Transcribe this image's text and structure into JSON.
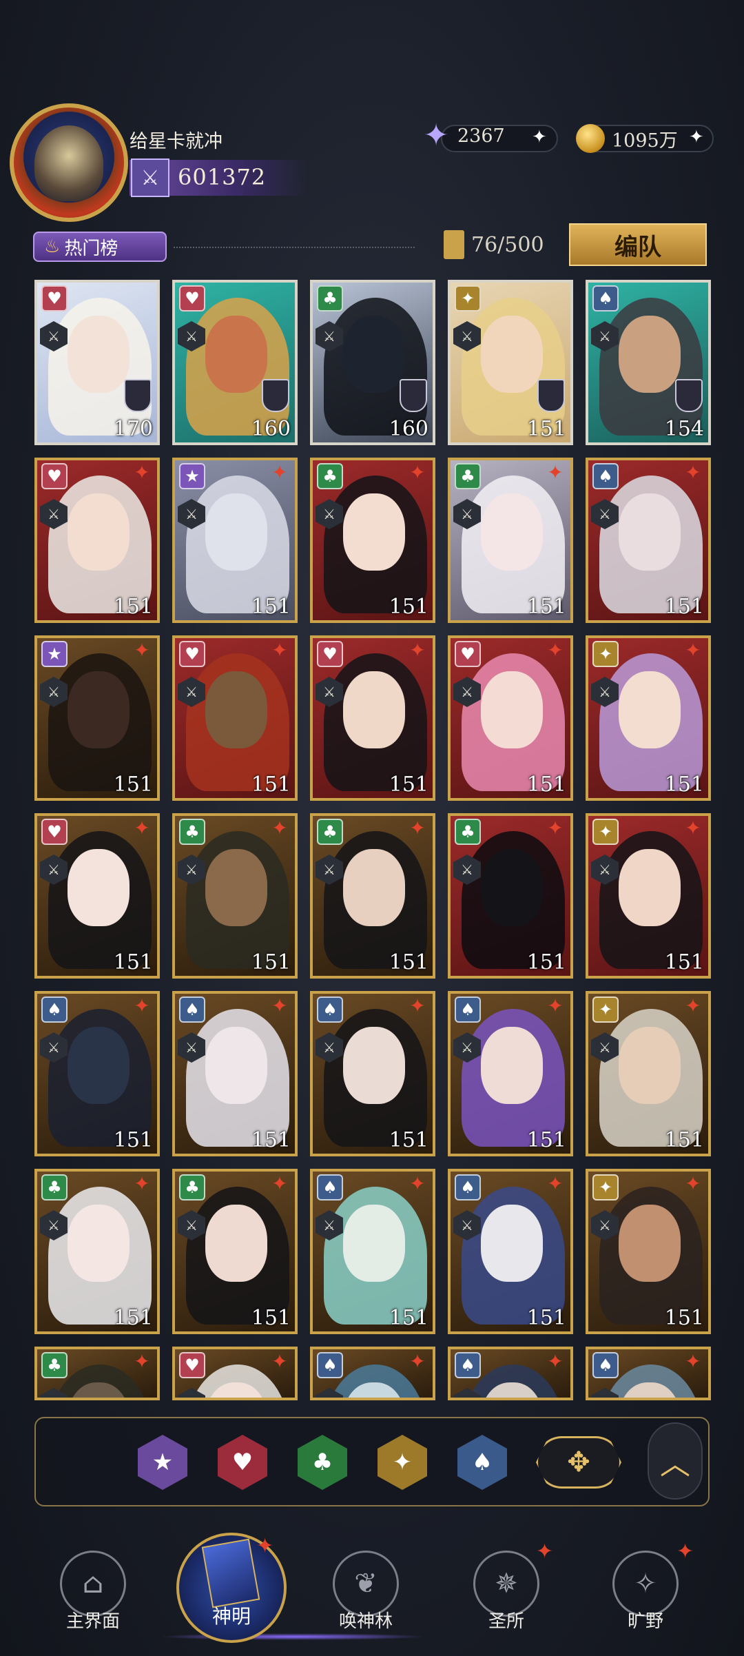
{
  "header": {
    "player_name": "给星卡就冲",
    "rank_score": "601372",
    "star_currency": "2367",
    "gold_currency": "1095万",
    "plus_symbol": "✦"
  },
  "list_bar": {
    "hot_tab_label": "热门榜",
    "card_count": "76/500",
    "team_button": "编队"
  },
  "cards": [
    {
      "level": "170",
      "suit": "heart",
      "suit_color": "#b24050",
      "top": true,
      "bg": [
        "#dfe6f2",
        "#a7b6d8"
      ],
      "face": "#f3e2d8",
      "hair": "#f7f3ea"
    },
    {
      "level": "160",
      "suit": "heart",
      "suit_color": "#b24050",
      "top": true,
      "bg": [
        "#2fb3a4",
        "#1d6e6a"
      ],
      "face": "#c9744a",
      "hair": "#d9a24a"
    },
    {
      "level": "160",
      "suit": "club",
      "suit_color": "#2d8a48",
      "top": true,
      "bg": [
        "#b9c4d6",
        "#3c4454"
      ],
      "face": "#1e2330",
      "hair": "#0f1218"
    },
    {
      "level": "151",
      "suit": "diamond",
      "suit_color": "#a8842c",
      "top": true,
      "bg": [
        "#e8d6b4",
        "#c9a870"
      ],
      "face": "#f1d6bc",
      "hair": "#e8cf8a"
    },
    {
      "level": "154",
      "suit": "spade",
      "suit_color": "#3d5c8c",
      "top": true,
      "bg": [
        "#2fb3a4",
        "#1b5d5a"
      ],
      "face": "#c9a080",
      "hair": "#3c3a40"
    },
    {
      "level": "151",
      "suit": "heart",
      "suit_color": "#b24050",
      "bg": [
        "#9c2a2a",
        "#5a1414"
      ],
      "face": "#f2ddd0",
      "hair": "#ecebe6"
    },
    {
      "level": "151",
      "suit": "star",
      "suit_color": "#7b56b8",
      "bg": [
        "#8a8fa6",
        "#4a4e60"
      ],
      "face": "#dfe2ea",
      "hair": "#d9dce6"
    },
    {
      "level": "151",
      "suit": "club",
      "suit_color": "#2d8a48",
      "bg": [
        "#9c2a2a",
        "#5a1414"
      ],
      "face": "#f2ddd0",
      "hair": "#141418"
    },
    {
      "level": "151",
      "suit": "club",
      "suit_color": "#2d8a48",
      "bg": [
        "#b7b2c2",
        "#5e5a6c"
      ],
      "face": "#f4e6e6",
      "hair": "#f2f0f4"
    },
    {
      "level": "151",
      "suit": "spade",
      "suit_color": "#3d5c8c",
      "bg": [
        "#9c2a2a",
        "#5a1414"
      ],
      "face": "#eadde0",
      "hair": "#dcdde4"
    },
    {
      "level": "151",
      "suit": "star",
      "suit_color": "#7b56b8",
      "bg": [
        "#6a4a24",
        "#2a1c0c"
      ],
      "face": "#3c2a22",
      "hair": "#1a1410"
    },
    {
      "level": "151",
      "suit": "heart",
      "suit_color": "#b24050",
      "bg": [
        "#9c2a2a",
        "#5a1414"
      ],
      "face": "#7a5a3a",
      "hair": "#a6331e"
    },
    {
      "level": "151",
      "suit": "heart",
      "suit_color": "#b24050",
      "bg": [
        "#9c2a2a",
        "#5a1414"
      ],
      "face": "#f0d8c8",
      "hair": "#141418"
    },
    {
      "level": "151",
      "suit": "heart",
      "suit_color": "#b24050",
      "bg": [
        "#9c2a2a",
        "#5a1414"
      ],
      "face": "#f4dcd4",
      "hair": "#e98ab0"
    },
    {
      "level": "151",
      "suit": "diamond",
      "suit_color": "#a8842c",
      "bg": [
        "#9c2a2a",
        "#5a1414"
      ],
      "face": "#f3ddd0",
      "hair": "#b89ad8"
    },
    {
      "level": "151",
      "suit": "heart",
      "suit_color": "#b24050",
      "bg": [
        "#6a4a24",
        "#2a1c0c"
      ],
      "face": "#f4e2dc",
      "hair": "#141418"
    },
    {
      "level": "151",
      "suit": "club",
      "suit_color": "#2d8a48",
      "bg": [
        "#6a4a24",
        "#2a1c0c"
      ],
      "face": "#8a6a4a",
      "hair": "#2a2a22"
    },
    {
      "level": "151",
      "suit": "club",
      "suit_color": "#2d8a48",
      "bg": [
        "#6a4a24",
        "#2a1c0c"
      ],
      "face": "#e8d0c0",
      "hair": "#141418"
    },
    {
      "level": "151",
      "suit": "club",
      "suit_color": "#2d8a48",
      "bg": [
        "#9c2a2a",
        "#5a1414"
      ],
      "face": "#141418",
      "hair": "#0c0c10"
    },
    {
      "level": "151",
      "suit": "diamond",
      "suit_color": "#a8842c",
      "bg": [
        "#9c2a2a",
        "#5a1414"
      ],
      "face": "#f0d6c6",
      "hair": "#141418"
    },
    {
      "level": "151",
      "suit": "spade",
      "suit_color": "#3d5c8c",
      "bg": [
        "#6a4a24",
        "#2a1c0c"
      ],
      "face": "#2a3448",
      "hair": "#1a2030"
    },
    {
      "level": "151",
      "suit": "spade",
      "suit_color": "#3d5c8c",
      "bg": [
        "#6a4a24",
        "#2a1c0c"
      ],
      "face": "#eee6e8",
      "hair": "#e6e4ec"
    },
    {
      "level": "151",
      "suit": "spade",
      "suit_color": "#3d5c8c",
      "bg": [
        "#6a4a24",
        "#2a1c0c"
      ],
      "face": "#eadcd4",
      "hair": "#141418"
    },
    {
      "level": "151",
      "suit": "spade",
      "suit_color": "#3d5c8c",
      "bg": [
        "#6a4a24",
        "#2a1c0c"
      ],
      "face": "#f0dcd6",
      "hair": "#7a54c0"
    },
    {
      "level": "151",
      "suit": "diamond",
      "suit_color": "#a8842c",
      "bg": [
        "#6a4a24",
        "#2a1c0c"
      ],
      "face": "#e6cdb8",
      "hair": "#d8d4c8"
    },
    {
      "level": "151",
      "suit": "club",
      "suit_color": "#2d8a48",
      "bg": [
        "#6a4a24",
        "#2a1c0c"
      ],
      "face": "#f4e6e2",
      "hair": "#ececf0"
    },
    {
      "level": "151",
      "suit": "club",
      "suit_color": "#2d8a48",
      "bg": [
        "#6a4a24",
        "#2a1c0c"
      ],
      "face": "#eedad0",
      "hair": "#141418"
    },
    {
      "level": "151",
      "suit": "spade",
      "suit_color": "#3d5c8c",
      "bg": [
        "#6a4a24",
        "#2a1c0c"
      ],
      "face": "#e4ece6",
      "hair": "#8ad0c8"
    },
    {
      "level": "151",
      "suit": "spade",
      "suit_color": "#3d5c8c",
      "bg": [
        "#6a4a24",
        "#2a1c0c"
      ],
      "face": "#e8e8ec",
      "hair": "#3a4a8a"
    },
    {
      "level": "151",
      "suit": "diamond",
      "suit_color": "#a8842c",
      "bg": [
        "#6a4a24",
        "#2a1c0c"
      ],
      "face": "#c09070",
      "hair": "#2a2220"
    },
    {
      "level": "",
      "suit": "club",
      "suit_color": "#2d8a48",
      "bg": [
        "#6a4a24",
        "#2a1c0c"
      ],
      "face": "#6a5a4a",
      "hair": "#2a2a22"
    },
    {
      "level": "",
      "suit": "heart",
      "suit_color": "#b24050",
      "bg": [
        "#6a4a24",
        "#2a1c0c"
      ],
      "face": "#f0e0d8",
      "hair": "#e6e4e0"
    },
    {
      "level": "",
      "suit": "spade",
      "suit_color": "#3d5c8c",
      "bg": [
        "#6a4a24",
        "#2a1c0c"
      ],
      "face": "#c8d8e0",
      "hair": "#4a7a9a"
    },
    {
      "level": "",
      "suit": "spade",
      "suit_color": "#3d5c8c",
      "bg": [
        "#6a4a24",
        "#2a1c0c"
      ],
      "face": "#d8d0c8",
      "hair": "#2a3a5a"
    },
    {
      "level": "",
      "suit": "spade",
      "suit_color": "#3d5c8c",
      "bg": [
        "#6a4a24",
        "#2a1c0c"
      ],
      "face": "#e0d0c4",
      "hair": "#6a8aa0"
    }
  ],
  "suit_glyphs": {
    "heart": "♥",
    "club": "♣",
    "spade": "♠",
    "diamond": "✦",
    "star": "★"
  },
  "filters": [
    {
      "name": "filter-star",
      "glyph": "★",
      "color": "#6a4a9c"
    },
    {
      "name": "filter-heart",
      "glyph": "♥",
      "color": "#9c2c3c"
    },
    {
      "name": "filter-club",
      "glyph": "♣",
      "color": "#2a7a3c"
    },
    {
      "name": "filter-diamond",
      "glyph": "✦",
      "color": "#9c7a2a"
    },
    {
      "name": "filter-spade",
      "glyph": "♠",
      "color": "#3a5a8c"
    }
  ],
  "filter_all_glyph": "✥",
  "collapse_glyph": "︿",
  "nav": {
    "home": "主界面",
    "gods": "神明",
    "summon": "唤神林",
    "sanctuary": "圣所",
    "wilds": "旷野"
  }
}
